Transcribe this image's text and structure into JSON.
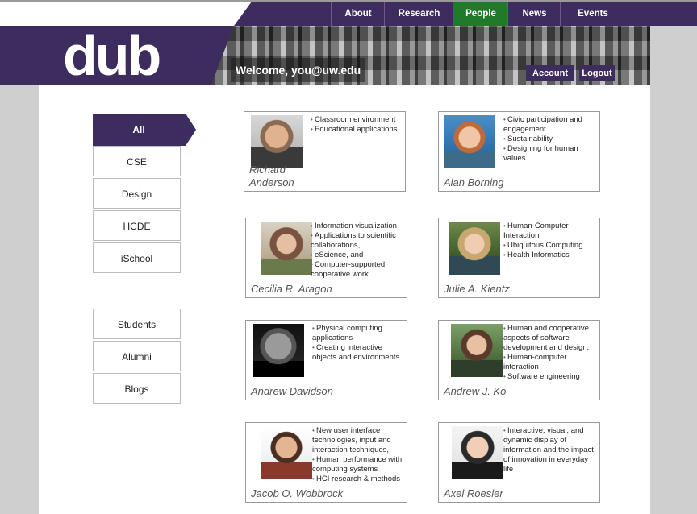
{
  "nav": {
    "items": [
      {
        "label": "About",
        "active": false
      },
      {
        "label": "Research",
        "active": false
      },
      {
        "label": "People",
        "active": true
      },
      {
        "label": "News",
        "active": false
      },
      {
        "label": "Events",
        "active": false
      }
    ]
  },
  "header": {
    "logo_text": "dub",
    "welcome": "Welcome,  you@uw.edu",
    "account_label": "Account",
    "logout_label": "Logout"
  },
  "filters": {
    "primary": [
      "All",
      "CSE",
      "Design",
      "HCDE",
      "iSchool"
    ],
    "secondary": [
      "Students",
      "Alumni",
      "Blogs"
    ]
  },
  "people": [
    {
      "name": "Richard Anderson",
      "photo": "photo-richard-anderson",
      "interests": [
        "Classroom environment",
        "Educational applications"
      ]
    },
    {
      "name": "Alan Borning",
      "photo": "photo-alan-borning",
      "interests": [
        "Civic participation and engagement",
        "Sustainability",
        "Designing for human values"
      ]
    },
    {
      "name": "Cecilia R. Aragon",
      "photo": "photo-cecilia-aragon",
      "interests": [
        "Information visualization",
        "Applications to scientific collaborations,",
        "eScience, and",
        "Computer-supported cooperative work"
      ]
    },
    {
      "name": "Julie A. Kientz",
      "photo": "photo-julie-kientz",
      "interests": [
        "Human-Computer Interaction",
        "Ubiquitous Computing",
        "Health Informatics"
      ]
    },
    {
      "name": "Andrew Davidson",
      "photo": "photo-andrew-davidson",
      "interests": [
        "Physical computing applications",
        "Creating interactive objects and environments"
      ]
    },
    {
      "name": "Andrew J. Ko",
      "photo": "photo-andrew-ko",
      "interests": [
        "Human and cooperative aspects of software development and design,",
        "Human-computer interaction",
        "Software engineering"
      ]
    },
    {
      "name": "Jacob O. Wobbrock",
      "photo": "photo-jacob-wobbrock",
      "interests": [
        "New user interface technologies, input and interaction techniques,",
        "Human performance with computing systems",
        "HCI research & methods"
      ]
    },
    {
      "name": "Axel Roesler",
      "photo": "photo-axel-roesler",
      "interests": [
        "Interactive, visual, and dynamic display of information and the impact of innovation in everyday life"
      ]
    }
  ],
  "colors": {
    "brand_purple": "#3d2c5e",
    "nav_active_green": "#1f7a2a",
    "page_gray": "#cfcfcf"
  }
}
